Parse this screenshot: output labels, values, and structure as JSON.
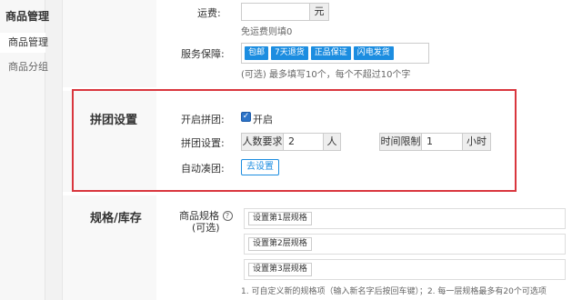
{
  "sidebar": {
    "title": "商品管理",
    "items": [
      {
        "label": "商品管理"
      },
      {
        "label": "商品分组"
      }
    ]
  },
  "shipping": {
    "label": "运费:",
    "value": "",
    "unit": "元",
    "hint": "免运费则填0"
  },
  "service": {
    "label": "服务保障:",
    "tags": [
      "包邮",
      "7天退货",
      "正品保证",
      "闪电发货"
    ],
    "hint": "(可选) 最多填写10个，每个不超过10个字"
  },
  "group_buy": {
    "section_title": "拼团设置",
    "open_label": "开启拼团:",
    "open_checkbox_label": "开启",
    "open_checked": true,
    "settings_label": "拼团设置:",
    "people_prefix": "人数要求",
    "people_value": "2",
    "people_unit": "人",
    "time_prefix": "时间限制",
    "time_value": "1",
    "time_unit": "小时",
    "auto_label": "自动凑团:",
    "auto_button": "去设置"
  },
  "spec": {
    "section_title": "规格/库存",
    "label_line1": "商品规格",
    "label_line2": "(可选)",
    "help_icon": "?",
    "rows": [
      {
        "button": "设置第1层规格"
      },
      {
        "button": "设置第2层规格"
      },
      {
        "button": "设置第3层规格"
      }
    ],
    "note": "1. 可自定义新的规格项（输入新名字后按回车键）；2. 每一层规格最多有20个可选项"
  }
}
